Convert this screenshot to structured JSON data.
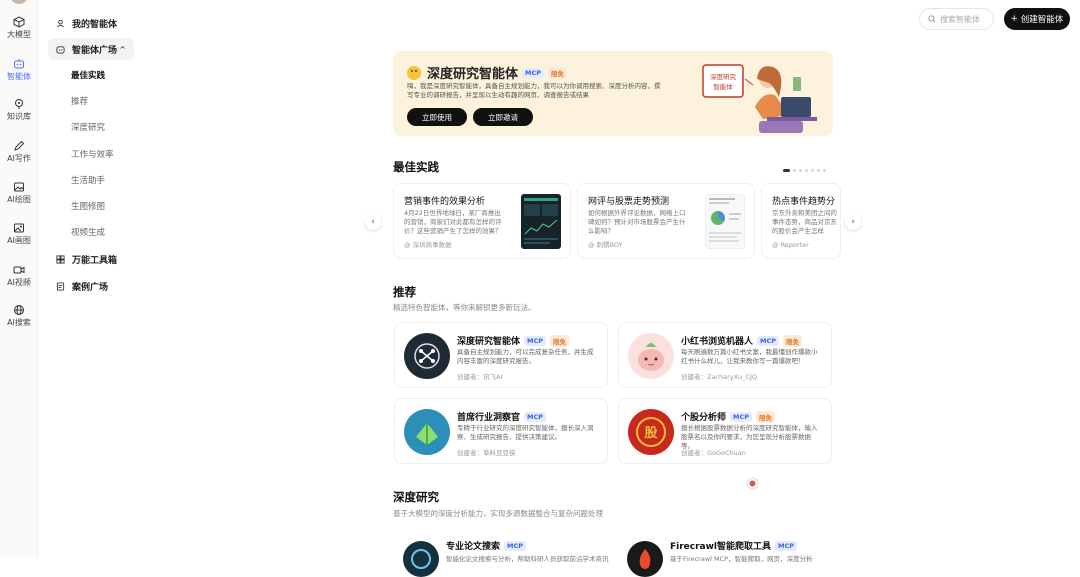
{
  "rail": [
    {
      "icon": "cube-icon",
      "label": "大模型"
    },
    {
      "icon": "agent-icon",
      "label": "智能体",
      "active": true
    },
    {
      "icon": "location-icon",
      "label": "知识库"
    },
    {
      "icon": "pen-icon",
      "label": "AI写作"
    },
    {
      "icon": "image-icon",
      "label": "AI绘图"
    },
    {
      "icon": "image-edit-icon",
      "label": "AI画图"
    },
    {
      "icon": "video-icon",
      "label": "AI视频"
    },
    {
      "icon": "globe-icon",
      "label": "AI搜索"
    }
  ],
  "nav": {
    "my_agents": "我的智能体",
    "agent_plaza": "智能体广场",
    "subs": [
      "最佳实践",
      "推荐",
      "深度研究",
      "工作与效率",
      "生活助手",
      "生图修图",
      "视频生成"
    ],
    "toolbox": "万能工具箱",
    "case_plaza": "案例广场"
  },
  "topbar": {
    "search_placeholder": "搜索智能体",
    "create_label": "创建智能体"
  },
  "banner": {
    "title": "深度研究智能体",
    "tag_mcp": "MCP",
    "tag_free": "限免",
    "desc": "嗨，我是深度研究智能体，具备自主规划能力，我可以为你调用搜索、深度分析内容，撰写专业的调研报告，并呈现以生动有趣的网页、调查报告或结果",
    "btn_use": "立即使用",
    "btn_invite": "立即邀请",
    "illus_text": "深度研究\n智能体"
  },
  "best": {
    "title": "最佳实践",
    "cards": [
      {
        "title": "营销事件的效果分析",
        "desc": "4月22日世界地球日，某厂商推出的营销，商家们对此都有怎样的评价？这些营销产生了怎样的效果？",
        "author": "@ 深圳商事数据"
      },
      {
        "title": "网评与股票走势预测",
        "desc": "如何根据外界评论数据，网络上口碑如何？预计对市场股票会产生什么影响？",
        "author": "@ 刺猬BOY"
      },
      {
        "title": "热点事件趋势分",
        "desc": "京东外卖和美团之间的事件态势，商品对京东的股价会产生怎样",
        "author": "@ Reporter"
      }
    ]
  },
  "rec": {
    "title": "推荐",
    "sub": "精选特色智能体，等你来解锁更多新玩法。",
    "cards": [
      {
        "title": "深度研究智能体",
        "tags": [
          "MCP",
          "限免"
        ],
        "desc": "具备自主规划能力，可以完成复杂任务，并生成内容丰富的深度研究报告。",
        "creator": "创建者：讯飞AI"
      },
      {
        "title": "小红书浏览机器人",
        "tags": [
          "MCP",
          "限免"
        ],
        "desc": "每天刷遍数万篇小红书文案，我最懂创作爆款小红书什么样儿，让我来教你写一篇爆款吧！",
        "creator": "创建者：ZacharyXu_CJQ"
      },
      {
        "title": "首席行业洞察官",
        "tags": [
          "MCP"
        ],
        "desc": "专精于行业研究的深度研究智能体，擅长深入洞察、生成研究报告、提供决策建议。",
        "creator": "创建者：草料豆豆侠"
      },
      {
        "title": "个股分析师",
        "tags": [
          "MCP",
          "限免"
        ],
        "desc": "擅长根据股票数据分析的深度研究智能体，输入股票名以及你的要求，为您呈现分析股票数据等。",
        "creator": "创建者：GoGoChuan"
      }
    ]
  },
  "deep": {
    "title": "深度研究",
    "sub": "基于大模型的深度分析能力，实现多源数据整合与复杂问题处理",
    "cards": [
      {
        "title": "专业论文搜索",
        "tags": [
          "MCP"
        ],
        "desc": "智能化论文搜索与分析，帮助科研人员获取前沿学术资讯"
      },
      {
        "title": "Firecrawl智能爬取工具",
        "tags": [
          "MCP"
        ],
        "desc": "基于Firecrawl MCP，智能爬取，网页，深度分析"
      }
    ]
  },
  "colors": {
    "accent": "#4a6cf7",
    "banner_bg": "#fdf3dc",
    "primary_btn": "#111111"
  }
}
